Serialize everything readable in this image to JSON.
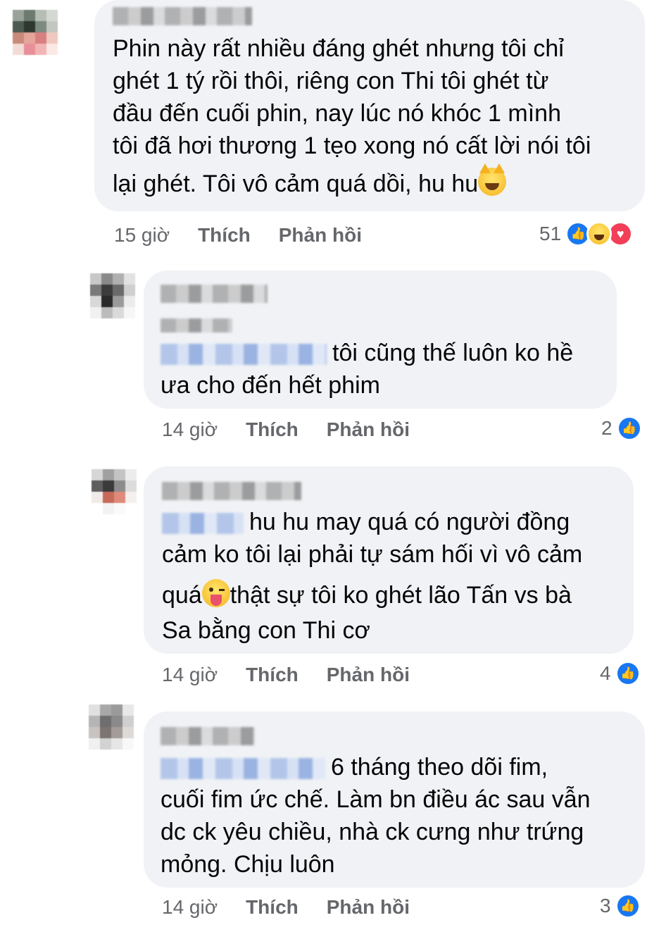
{
  "comments": [
    {
      "lines": [
        "Phin này rất nhiều đáng ghét nhưng tôi chỉ",
        "ghét 1 tý rồi thôi, riêng con Thi tôi ghét từ",
        "đầu đến cuối phin, nay lúc nó khóc 1 mình",
        "tôi đã hơi thương 1 tẹo xong nó cất lời nói tôi",
        "lại ghét. Tôi vô cảm quá dồi, hu hu"
      ],
      "time": "15 giờ",
      "like_label": "Thích",
      "reply_label": "Phản hồi",
      "reaction_count": "51",
      "reaction_icons": [
        "like-icon",
        "haha-icon",
        "love-icon"
      ],
      "trailing_emoji": "laughing-cat-icon"
    },
    {
      "lines": [
        "tôi cũng thế luôn ko hề",
        "ưa cho đến hết phim"
      ],
      "time": "14 giờ",
      "like_label": "Thích",
      "reply_label": "Phản hồi",
      "reaction_count": "2",
      "reaction_icons": [
        "like-icon"
      ]
    },
    {
      "lines": [
        "hu hu may quá có người đồng",
        "cảm ko tôi lại phải tự sám hối vì vô cảm",
        "quá",
        "thật sự tôi ko ghét lão Tấn vs bà",
        "Sa bằng con Thi cơ"
      ],
      "time": "14 giờ",
      "like_label": "Thích",
      "reply_label": "Phản hồi",
      "reaction_count": "4",
      "reaction_icons": [
        "like-icon"
      ],
      "inline_emoji": "winking-tongue-face-icon"
    },
    {
      "lines": [
        "6 tháng theo dõi fim,",
        "cuối fim ức chế. Làm bn điều ác sau vẫn",
        "dc ck yêu chiều, nhà ck cưng như trứng",
        "mỏng. Chịu luôn"
      ],
      "time": "14 giờ",
      "like_label": "Thích",
      "reply_label": "Phản hồi",
      "reaction_count": "3",
      "reaction_icons": [
        "like-icon"
      ]
    }
  ],
  "colors": {
    "bubble": "#f0f2f5",
    "meta_text": "#65676b",
    "like_blue": "#1877f2",
    "love_red": "#f33e58"
  }
}
